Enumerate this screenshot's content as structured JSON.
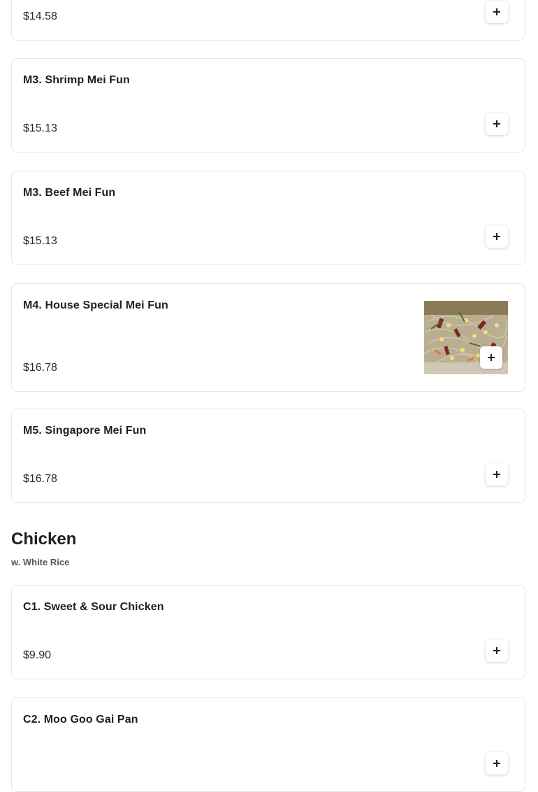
{
  "items": [
    {
      "name": "",
      "price": "$14.58"
    },
    {
      "name": "M3. Shrimp Mei Fun",
      "price": "$15.13"
    },
    {
      "name": "M3. Beef Mei Fun",
      "price": "$15.13"
    },
    {
      "name": "M4. House Special Mei Fun",
      "price": "$16.78"
    },
    {
      "name": "M5. Singapore Mei Fun",
      "price": "$16.78"
    }
  ],
  "section": {
    "title": "Chicken",
    "subtitle": "w. White Rice"
  },
  "chicken_items": [
    {
      "name": "C1. Sweet & Sour Chicken",
      "price": "$9.90"
    },
    {
      "name": "C2. Moo Goo Gai Pan",
      "price": ""
    }
  ],
  "icons": {
    "add": "plus-icon"
  }
}
